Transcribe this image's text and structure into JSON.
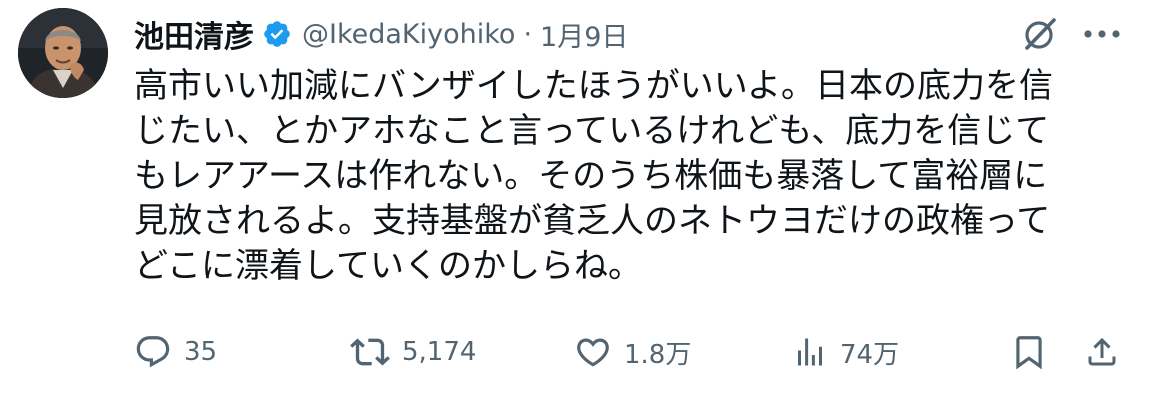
{
  "tweet": {
    "author_name": "池田清彦",
    "handle": "@IkedaKiyohiko",
    "separator": "·",
    "date": "1月9日",
    "lines": [
      "高市いい加減にバンザイしたほうがいいよ。日本の底力を信",
      "じたい、とかアホなこと言っているけれども、底力を信じて",
      "もレアアースは作れない。そのうち株価も暴落して富裕層に",
      "見放されるよ。支持基盤が貧乏人のネトウヨだけの政権って",
      "どこに漂着していくのかしらね。"
    ]
  },
  "metrics": {
    "replies": "35",
    "reposts": "5,174",
    "likes": "1.8万",
    "views": "74万"
  },
  "icons": {
    "verified": "verified-badge-icon",
    "grok": "grok-icon",
    "more": "more-icon",
    "reply": "reply-icon",
    "repost": "repost-icon",
    "like": "like-icon",
    "views": "views-icon",
    "bookmark": "bookmark-icon",
    "share": "share-icon"
  },
  "colors": {
    "text": "#0f1419",
    "secondary": "#536471",
    "verified": "#1d9bf0"
  }
}
